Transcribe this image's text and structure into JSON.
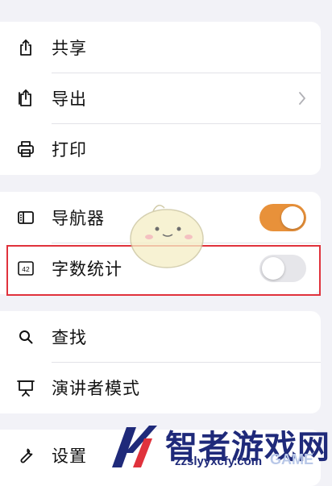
{
  "menu": {
    "groups": [
      {
        "items": [
          {
            "label": "共享",
            "icon": "share-icon"
          },
          {
            "label": "导出",
            "icon": "export-icon",
            "chevron": true
          },
          {
            "label": "打印",
            "icon": "printer-icon"
          }
        ]
      },
      {
        "items": [
          {
            "label": "导航器",
            "icon": "sidebar-icon",
            "toggle": true
          },
          {
            "label": "字数统计",
            "icon": "word-count-icon",
            "toggle": false
          }
        ]
      },
      {
        "items": [
          {
            "label": "查找",
            "icon": "search-icon"
          },
          {
            "label": "演讲者模式",
            "icon": "presenter-icon"
          }
        ]
      },
      {
        "items": [
          {
            "label": "设置",
            "icon": "wrench-icon"
          }
        ]
      }
    ]
  },
  "icons": {
    "word_count_text": "42"
  },
  "colors": {
    "toggle_on": "#e8913a",
    "highlight": "#e0323c",
    "watermark": "#1f2a7a"
  },
  "watermark": {
    "title": "智者游戏网",
    "url": "zzslyyxcfy.com",
    "game": "GAME"
  }
}
